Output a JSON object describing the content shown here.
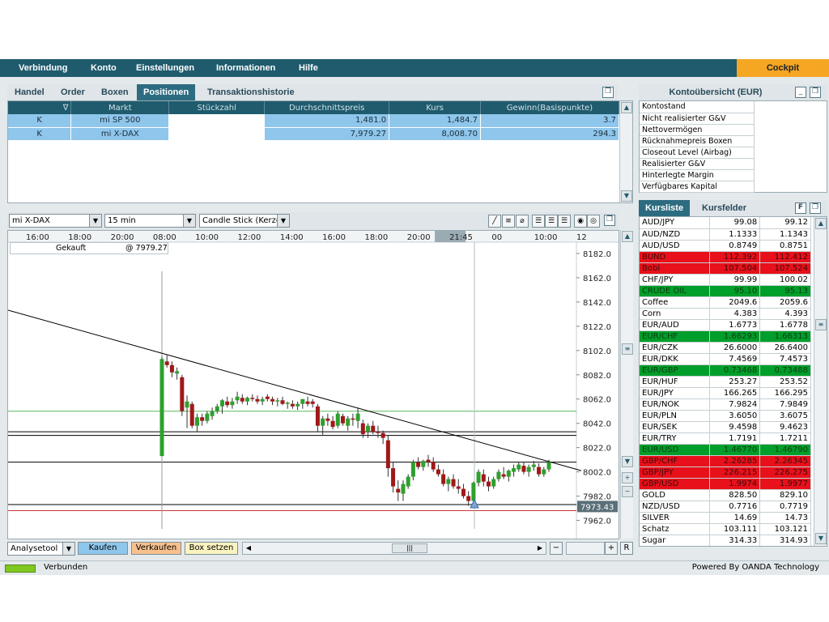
{
  "menu": [
    "Verbindung",
    "Konto",
    "Einstellungen",
    "Informationen",
    "Hilfe"
  ],
  "cockpit_label": "Cockpit",
  "trade_tabs": [
    "Handel",
    "Order",
    "Boxen",
    "Positionen",
    "Transaktionshistorie"
  ],
  "positions": {
    "headers": [
      "∇",
      "Markt",
      "Stückzahl",
      "Durchschnittspreis",
      "Kurs",
      "Gewinn(Basispunkte)"
    ],
    "rows": [
      {
        "side": "K",
        "market": "mi SP 500",
        "qty": "",
        "avg": "1,481.0",
        "price": "1,484.7",
        "gain": "3.7"
      },
      {
        "side": "K",
        "market": "mi X-DAX",
        "qty": "",
        "avg": "7,979.27",
        "price": "8,008.70",
        "gain": "294.3"
      }
    ]
  },
  "chart_toolbar": {
    "market": "mi X-DAX",
    "interval": "15 min",
    "type": "Candle Stick (Kerze"
  },
  "chart_data": {
    "type": "candlestick",
    "time_labels": [
      "16:00",
      "18:00",
      "20:00",
      "08:00",
      "10:00",
      "12:00",
      "14:00",
      "16:00",
      "18:00",
      "20:00",
      "21:45",
      "00",
      "10:00",
      "12"
    ],
    "y_ticks": [
      "8182.0",
      "8162.0",
      "8142.0",
      "8122.0",
      "8102.0",
      "8082.0",
      "8062.0",
      "8042.0",
      "8022.0",
      "8002.0",
      "7982.0",
      "7962.0"
    ],
    "ylim": [
      7955,
      8190
    ],
    "current_price_label": "7973.43",
    "position_marker": {
      "label": "Gekauft",
      "price_label": "@ 7979.27"
    },
    "horizontal_lines": [
      {
        "price": 8052,
        "color": "#5cb85c"
      },
      {
        "price": 8035,
        "color": "#000000"
      },
      {
        "price": 8032,
        "color": "#000000"
      },
      {
        "price": 8010,
        "color": "#000000"
      },
      {
        "price": 7975,
        "color": "#000000"
      },
      {
        "price": 7970,
        "color": "#cc3333"
      }
    ],
    "trendline": {
      "from": {
        "bar": 0,
        "price": 8125
      },
      "to": {
        "bar": 95,
        "price": 8003
      }
    },
    "candles": [
      [
        8015,
        8097,
        8015,
        8095
      ],
      [
        8093,
        8098,
        8088,
        8090
      ],
      [
        8090,
        8093,
        8080,
        8084
      ],
      [
        8083,
        8088,
        8078,
        8085
      ],
      [
        8080,
        8082,
        8048,
        8052
      ],
      [
        8055,
        8065,
        8038,
        8060
      ],
      [
        8058,
        8060,
        8038,
        8040
      ],
      [
        8040,
        8050,
        8035,
        8047
      ],
      [
        8047,
        8050,
        8040,
        8044
      ],
      [
        8044,
        8052,
        8042,
        8050
      ],
      [
        8048,
        8055,
        8045,
        8052
      ],
      [
        8052,
        8058,
        8050,
        8056
      ],
      [
        8056,
        8062,
        8050,
        8061
      ],
      [
        8060,
        8064,
        8055,
        8057
      ],
      [
        8057,
        8063,
        8054,
        8060
      ],
      [
        8061,
        8068,
        8058,
        8064
      ],
      [
        8063,
        8066,
        8058,
        8060
      ],
      [
        8060,
        8064,
        8057,
        8063
      ],
      [
        8063,
        8066,
        8060,
        8062
      ],
      [
        8062,
        8065,
        8058,
        8060
      ],
      [
        8060,
        8064,
        8057,
        8062
      ],
      [
        8064,
        8066,
        8060,
        8062
      ],
      [
        8062,
        8064,
        8057,
        8060
      ],
      [
        8060,
        8063,
        8056,
        8061
      ],
      [
        8061,
        8064,
        8057,
        8058
      ],
      [
        8058,
        8060,
        8054,
        8059
      ],
      [
        8058,
        8061,
        8054,
        8056
      ],
      [
        8056,
        8060,
        8053,
        8058
      ],
      [
        8058,
        8062,
        8054,
        8062
      ],
      [
        8060,
        8064,
        8056,
        8058
      ],
      [
        8060,
        8062,
        8055,
        8058
      ],
      [
        8056,
        8058,
        8035,
        8040
      ],
      [
        8040,
        8048,
        8032,
        8046
      ],
      [
        8046,
        8050,
        8040,
        8044
      ],
      [
        8044,
        8048,
        8037,
        8039
      ],
      [
        8040,
        8052,
        8038,
        8050
      ],
      [
        8048,
        8050,
        8040,
        8042
      ],
      [
        8040,
        8048,
        8036,
        8046
      ],
      [
        8046,
        8050,
        8040,
        8045
      ],
      [
        8044,
        8055,
        8038,
        8050
      ],
      [
        8042,
        8045,
        8030,
        8033
      ],
      [
        8035,
        8042,
        8030,
        8040
      ],
      [
        8040,
        8044,
        8033,
        8035
      ],
      [
        8035,
        8040,
        8030,
        8034
      ],
      [
        8034,
        8036,
        8025,
        8030
      ],
      [
        8028,
        8032,
        7998,
        8005
      ],
      [
        8005,
        8010,
        7985,
        7990
      ],
      [
        7988,
        7995,
        7978,
        7985
      ],
      [
        7984,
        7995,
        7978,
        7992
      ],
      [
        7990,
        8000,
        7988,
        7998
      ],
      [
        7998,
        8012,
        7995,
        8010
      ],
      [
        8010,
        8014,
        8004,
        8006
      ],
      [
        8006,
        8012,
        8003,
        8011
      ],
      [
        8012,
        8016,
        8006,
        8010
      ],
      [
        8010,
        8014,
        8002,
        8004
      ],
      [
        8004,
        8008,
        7998,
        8000
      ],
      [
        8000,
        8004,
        7990,
        7992
      ],
      [
        7992,
        7998,
        7986,
        7996
      ],
      [
        7996,
        8000,
        7988,
        7990
      ],
      [
        7990,
        7996,
        7984,
        7988
      ],
      [
        7988,
        7992,
        7980,
        7982
      ],
      [
        7982,
        7986,
        7974,
        7978
      ],
      [
        7978,
        7994,
        7976,
        7993
      ],
      [
        7993,
        8004,
        7990,
        8002
      ],
      [
        8000,
        8004,
        7990,
        7994
      ],
      [
        7994,
        7998,
        7986,
        7990
      ],
      [
        7990,
        7998,
        7988,
        7996
      ],
      [
        7996,
        8004,
        7994,
        8002
      ],
      [
        8000,
        8006,
        7996,
        7998
      ],
      [
        7998,
        8004,
        7994,
        8003
      ],
      [
        8002,
        8008,
        7998,
        8005
      ],
      [
        8004,
        8010,
        8002,
        8008
      ],
      [
        8007,
        8010,
        8000,
        8002
      ],
      [
        8002,
        8008,
        7998,
        8006
      ],
      [
        8006,
        8011,
        8003,
        8008
      ],
      [
        8006,
        8009,
        7998,
        8000
      ],
      [
        8000,
        8006,
        7998,
        8004
      ],
      [
        8004,
        8012,
        8002,
        8010
      ]
    ]
  },
  "chart_buttons": {
    "analysetool": "Analysetool",
    "kaufen": "Kaufen",
    "verkaufen": "Verkaufen",
    "box": "Box setzen",
    "r": "R"
  },
  "account": {
    "title": "Kontoübersicht (EUR)",
    "rows": [
      "Kontostand",
      "Nicht realisierter G&V",
      "Nettovermögen",
      "Rücknahmepreis Boxen",
      "Closeout Level (Airbag)",
      "Realisierter G&V",
      "Hinterlegte Margin",
      "Verfügbares Kapital"
    ]
  },
  "quote_tabs": [
    "Kursliste",
    "Kursfelder"
  ],
  "quotes": [
    {
      "name": "AUD/JPY",
      "bid": "99.08",
      "ask": "99.12",
      "state": "none"
    },
    {
      "name": "AUD/NZD",
      "bid": "1.1333",
      "ask": "1.1343",
      "state": "none"
    },
    {
      "name": "AUD/USD",
      "bid": "0.8749",
      "ask": "0.8751",
      "state": "none"
    },
    {
      "name": "BUND",
      "bid": "112.392",
      "ask": "112.412",
      "state": "down"
    },
    {
      "name": "Bobl",
      "bid": "107.504",
      "ask": "107.524",
      "state": "down"
    },
    {
      "name": "CHF/JPY",
      "bid": "99.99",
      "ask": "100.02",
      "state": "none"
    },
    {
      "name": "CRUDE OIL",
      "bid": "95.10",
      "ask": "95.13",
      "state": "up"
    },
    {
      "name": "Coffee",
      "bid": "2049.6",
      "ask": "2059.6",
      "state": "none"
    },
    {
      "name": "Corn",
      "bid": "4.383",
      "ask": "4.393",
      "state": "none"
    },
    {
      "name": "EUR/AUD",
      "bid": "1.6773",
      "ask": "1.6778",
      "state": "none"
    },
    {
      "name": "EUR/CHF",
      "bid": "1.66293",
      "ask": "1.66313",
      "state": "up"
    },
    {
      "name": "EUR/CZK",
      "bid": "26.6000",
      "ask": "26.6400",
      "state": "none"
    },
    {
      "name": "EUR/DKK",
      "bid": "7.4569",
      "ask": "7.4573",
      "state": "none"
    },
    {
      "name": "EUR/GBP",
      "bid": "0.73468",
      "ask": "0.73488",
      "state": "up"
    },
    {
      "name": "EUR/HUF",
      "bid": "253.27",
      "ask": "253.52",
      "state": "none"
    },
    {
      "name": "EUR/JPY",
      "bid": "166.265",
      "ask": "166.295",
      "state": "none"
    },
    {
      "name": "EUR/NOK",
      "bid": "7.9824",
      "ask": "7.9849",
      "state": "none"
    },
    {
      "name": "EUR/PLN",
      "bid": "3.6050",
      "ask": "3.6075",
      "state": "none"
    },
    {
      "name": "EUR/SEK",
      "bid": "9.4598",
      "ask": "9.4623",
      "state": "none"
    },
    {
      "name": "EUR/TRY",
      "bid": "1.7191",
      "ask": "1.7211",
      "state": "none"
    },
    {
      "name": "EUR/USD",
      "bid": "1.46770",
      "ask": "1.46790",
      "state": "up"
    },
    {
      "name": "GBP/CHF",
      "bid": "2.26285",
      "ask": "2.26345",
      "state": "down"
    },
    {
      "name": "GBP/JPY",
      "bid": "226.215",
      "ask": "226.275",
      "state": "down"
    },
    {
      "name": "GBP/USD",
      "bid": "1.9974",
      "ask": "1.9977",
      "state": "down"
    },
    {
      "name": "GOLD",
      "bid": "828.50",
      "ask": "829.10",
      "state": "none"
    },
    {
      "name": "NZD/USD",
      "bid": "0.7716",
      "ask": "0.7719",
      "state": "none"
    },
    {
      "name": "SILVER",
      "bid": "14.69",
      "ask": "14.73",
      "state": "none"
    },
    {
      "name": "Schatz",
      "bid": "103.111",
      "ask": "103.121",
      "state": "none"
    },
    {
      "name": "Sugar",
      "bid": "314.33",
      "ask": "314.93",
      "state": "none"
    }
  ],
  "status": {
    "connection": "Verbunden",
    "powered_by": "Powered By OANDA Technology"
  },
  "colors": {
    "up": "#009e2a",
    "down": "#e8101a",
    "brand": "#1f5b6d",
    "accent": "#f5a623"
  }
}
